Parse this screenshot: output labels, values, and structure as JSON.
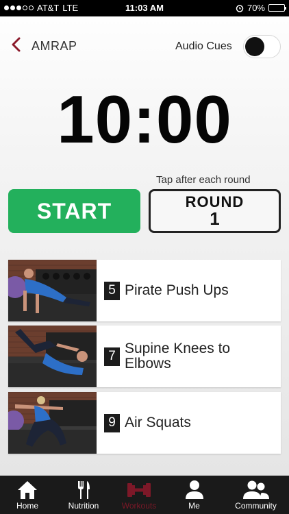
{
  "status_bar": {
    "carrier": "AT&T",
    "network": "LTE",
    "time": "11:03 AM",
    "battery": "70%",
    "battery_level": 0.7
  },
  "header": {
    "title": "AMRAP",
    "audio_cues_label": "Audio Cues",
    "audio_cues_on": false
  },
  "timer": {
    "display": "10:00"
  },
  "controls": {
    "hint": "Tap after each round",
    "start_label": "START",
    "round_label": "ROUND",
    "round_number": "1"
  },
  "exercises": [
    {
      "reps": "5",
      "name": "Pirate Push Ups"
    },
    {
      "reps": "7",
      "name": "Supine Knees to Elbows"
    },
    {
      "reps": "9",
      "name": "Air Squats"
    }
  ],
  "tab_bar": {
    "tabs": [
      {
        "label": "Home",
        "icon": "home-icon"
      },
      {
        "label": "Nutrition",
        "icon": "fork-knife-icon"
      },
      {
        "label": "Workouts",
        "icon": "dumbbell-icon",
        "active": true
      },
      {
        "label": "Me",
        "icon": "person-icon"
      },
      {
        "label": "Community",
        "icon": "group-icon"
      }
    ]
  },
  "colors": {
    "accent_green": "#23b05c",
    "active_tab": "#7d1828",
    "back_chevron": "#8b1a2b"
  }
}
